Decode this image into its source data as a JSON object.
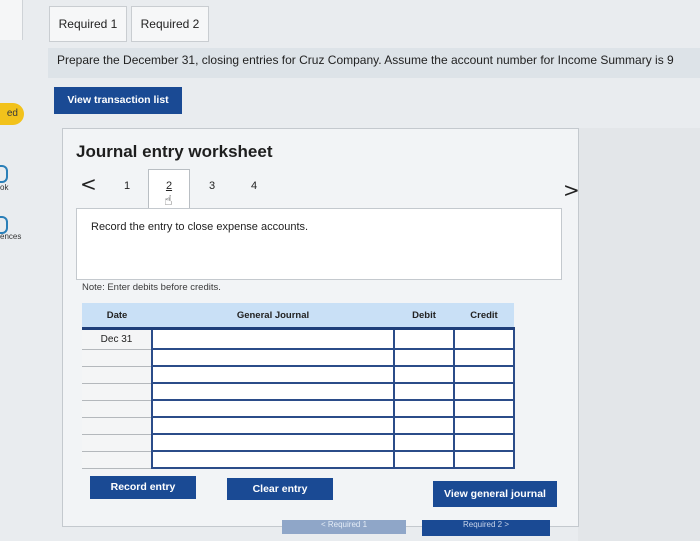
{
  "sidebar": {
    "badge_text": "ed",
    "item1_label": "ok",
    "item2_label": "ences"
  },
  "tabs": [
    {
      "label": "Required 1"
    },
    {
      "label": "Required 2"
    }
  ],
  "instructions": "Prepare the December 31, closing entries for Cruz Company. Assume the account number for Income Summary is 9",
  "view_transaction_list_label": "View transaction list",
  "worksheet": {
    "title": "Journal entry worksheet",
    "nav_prev": "<",
    "nav_next": ">",
    "steps": [
      "1",
      "2",
      "3",
      "4"
    ],
    "active_step": "2",
    "description": "Record the entry to close expense accounts.",
    "note": "Note: Enter debits before credits."
  },
  "journal": {
    "headers": {
      "date": "Date",
      "general_journal": "General Journal",
      "debit": "Debit",
      "credit": "Credit"
    },
    "rows": [
      {
        "date": "Dec 31",
        "account": "",
        "debit": "",
        "credit": ""
      },
      {
        "date": "",
        "account": "",
        "debit": "",
        "credit": ""
      },
      {
        "date": "",
        "account": "",
        "debit": "",
        "credit": ""
      },
      {
        "date": "",
        "account": "",
        "debit": "",
        "credit": ""
      },
      {
        "date": "",
        "account": "",
        "debit": "",
        "credit": ""
      },
      {
        "date": "",
        "account": "",
        "debit": "",
        "credit": ""
      },
      {
        "date": "",
        "account": "",
        "debit": "",
        "credit": ""
      },
      {
        "date": "",
        "account": "",
        "debit": "",
        "credit": ""
      }
    ]
  },
  "buttons": {
    "record_entry": "Record entry",
    "clear_entry": "Clear entry",
    "view_general_journal": "View general journal"
  },
  "footer": {
    "prev_label": "< Required 1",
    "next_label": "Required 2 >"
  },
  "colors": {
    "accent": "#1a4a94",
    "table_header": "#c9e0f6",
    "badge": "#f2c21b"
  }
}
